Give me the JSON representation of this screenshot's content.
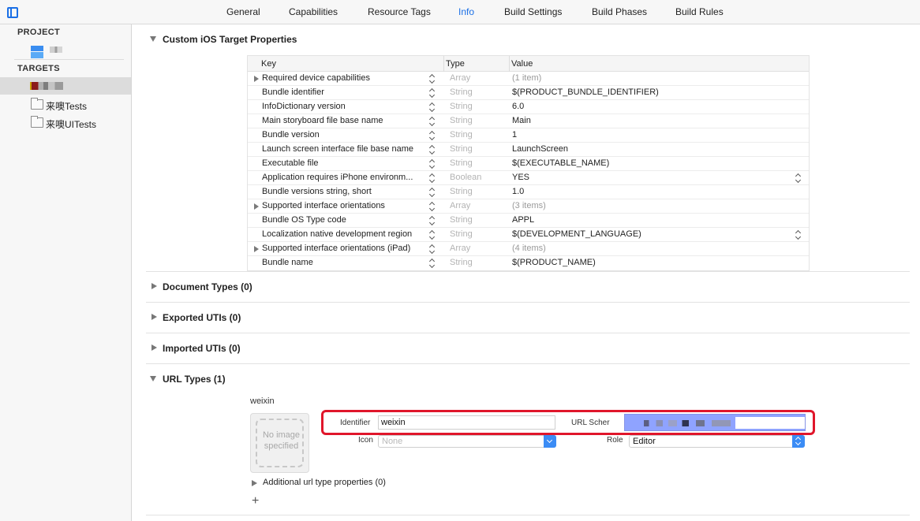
{
  "tabs": [
    {
      "label": "General",
      "active": false
    },
    {
      "label": "Capabilities",
      "active": false
    },
    {
      "label": "Resource Tags",
      "active": false
    },
    {
      "label": "Info",
      "active": true
    },
    {
      "label": "Build Settings",
      "active": false
    },
    {
      "label": "Build Phases",
      "active": false
    },
    {
      "label": "Build Rules",
      "active": false
    }
  ],
  "sidebar": {
    "project_heading": "PROJECT",
    "targets_heading": "TARGETS",
    "targets": [
      {
        "label": "",
        "selected": true
      },
      {
        "label": "来噢Tests",
        "selected": false
      },
      {
        "label": "来噢UITests",
        "selected": false
      }
    ]
  },
  "custom_properties": {
    "title": "Custom iOS Target Properties",
    "columns": {
      "key": "Key",
      "type": "Type",
      "value": "Value"
    },
    "rows": [
      {
        "key": "Required device capabilities",
        "type": "Array",
        "value": "(1 item)",
        "expandable": true,
        "value_muted": true
      },
      {
        "key": "Bundle identifier",
        "type": "String",
        "value": "$(PRODUCT_BUNDLE_IDENTIFIER)"
      },
      {
        "key": "InfoDictionary version",
        "type": "String",
        "value": "6.0"
      },
      {
        "key": "Main storyboard file base name",
        "type": "String",
        "value": "Main"
      },
      {
        "key": "Bundle version",
        "type": "String",
        "value": "1"
      },
      {
        "key": "Launch screen interface file base name",
        "type": "String",
        "value": "LaunchScreen"
      },
      {
        "key": "Executable file",
        "type": "String",
        "value": "$(EXECUTABLE_NAME)"
      },
      {
        "key": "Application requires iPhone environm...",
        "type": "Boolean",
        "value": "YES",
        "value_popup": true
      },
      {
        "key": "Bundle versions string, short",
        "type": "String",
        "value": "1.0"
      },
      {
        "key": "Supported interface orientations",
        "type": "Array",
        "value": "(3 items)",
        "expandable": true,
        "value_muted": true
      },
      {
        "key": "Bundle OS Type code",
        "type": "String",
        "value": "APPL"
      },
      {
        "key": "Localization native development region",
        "type": "String",
        "value": "$(DEVELOPMENT_LANGUAGE)",
        "value_popup": true
      },
      {
        "key": "Supported interface orientations (iPad)",
        "type": "Array",
        "value": "(4 items)",
        "expandable": true,
        "value_muted": true
      },
      {
        "key": "Bundle name",
        "type": "String",
        "value": "$(PRODUCT_NAME)"
      }
    ]
  },
  "sections": {
    "document_types": "Document Types (0)",
    "exported_utis": "Exported UTIs (0)",
    "imported_utis": "Imported UTIs (0)",
    "url_types": "URL Types (1)"
  },
  "url_type": {
    "name": "weixin",
    "no_image_text": "No image specified",
    "identifier_label": "Identifier",
    "identifier_value": "weixin",
    "url_schemes_label": "URL Scher",
    "icon_label": "Icon",
    "icon_placeholder": "None",
    "role_label": "Role",
    "role_value": "Editor",
    "additional_properties": "Additional url type properties (0)",
    "add_symbol": "+"
  },
  "colors": {
    "accent": "#1a6fe6",
    "highlight_border": "#e0162b",
    "selection_fill": "#8fa3ff"
  }
}
